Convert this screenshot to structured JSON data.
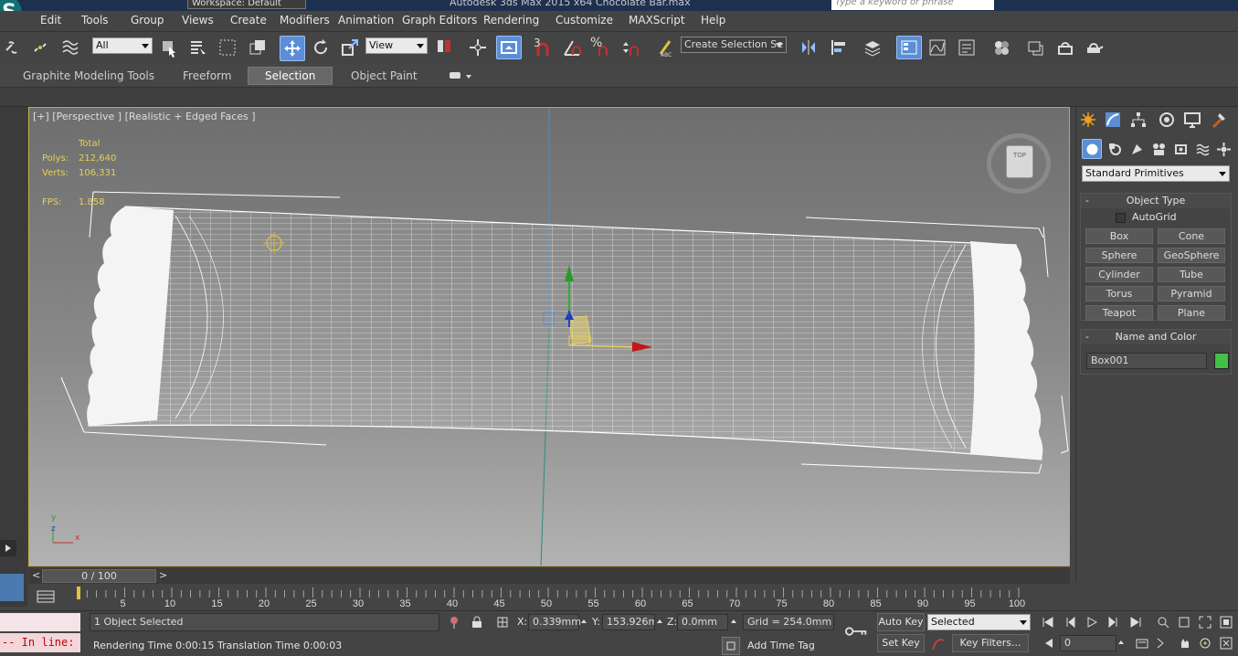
{
  "titlebar": {
    "workspace": "Workspace: Default",
    "app_title": "Autodesk 3ds Max  2015 x64      Chocolate Bar.max",
    "search_placeholder": "Type a keyword or phrase"
  },
  "logo_letter": "S",
  "menu": [
    "Edit",
    "Tools",
    "Group",
    "Views",
    "Create",
    "Modifiers",
    "Animation",
    "Graph Editors",
    "Rendering",
    "Customize",
    "MAXScript",
    "Help"
  ],
  "toolbar": {
    "selection_filter": "All",
    "ref_coord": "View",
    "snap_label_3": "3",
    "named_selection": "Create Selection Se"
  },
  "ribbon": {
    "tabs": [
      "Graphite Modeling Tools",
      "Freeform",
      "Selection",
      "Object Paint"
    ],
    "active_tab": "Selection"
  },
  "viewport": {
    "label": "[+] [Perspective ] [Realistic + Edged Faces ]",
    "stats_header": "Total",
    "polys_label": "Polys:",
    "polys_value": "212,640",
    "verts_label": "Verts:",
    "verts_value": "106,331",
    "fps_label": "FPS:",
    "fps_value": "1.858",
    "viewcube_label": "TOP",
    "axis_x": "x",
    "axis_y": "y",
    "axis_z": "z"
  },
  "command_panel": {
    "dropdown": "Standard Primitives",
    "object_type_title": "Object Type",
    "autogrid": "AutoGrid",
    "buttons": [
      "Box",
      "Cone",
      "Sphere",
      "GeoSphere",
      "Cylinder",
      "Tube",
      "Torus",
      "Pyramid",
      "Teapot",
      "Plane"
    ],
    "name_color_title": "Name and Color",
    "object_name": "Box001",
    "object_color": "#44c044"
  },
  "timeline": {
    "frame_display": "0 / 100",
    "prev": "<",
    "next": ">",
    "ticks": [
      "5",
      "10",
      "15",
      "20",
      "25",
      "30",
      "35",
      "40",
      "45",
      "50",
      "55",
      "60",
      "65",
      "70",
      "75",
      "80",
      "85",
      "90",
      "95",
      "100"
    ]
  },
  "status": {
    "maxscript_text": "-- In line:",
    "selection_status": "1 Object Selected",
    "prompt": "Rendering Time  0:00:15    Translation Time  0:00:03",
    "x_label": "X:",
    "x_value": "0.339mm",
    "y_label": "Y:",
    "y_value": "153.926mm",
    "z_label": "Z:",
    "z_value": "0.0mm",
    "grid": "Grid = 254.0mm",
    "auto_key": "Auto Key",
    "set_key": "Set Key",
    "key_mode": "Selected",
    "add_time_tag": "Add Time Tag",
    "key_filters": "Key Filters...",
    "current_frame": "0"
  },
  "colors": {
    "accent": "#5b8ed6",
    "viewport_border": "#c8a84a",
    "stats_text": "#e6d05a",
    "maxscript_bg": "#f2d6dc",
    "maxscript_text": "#c00000"
  }
}
